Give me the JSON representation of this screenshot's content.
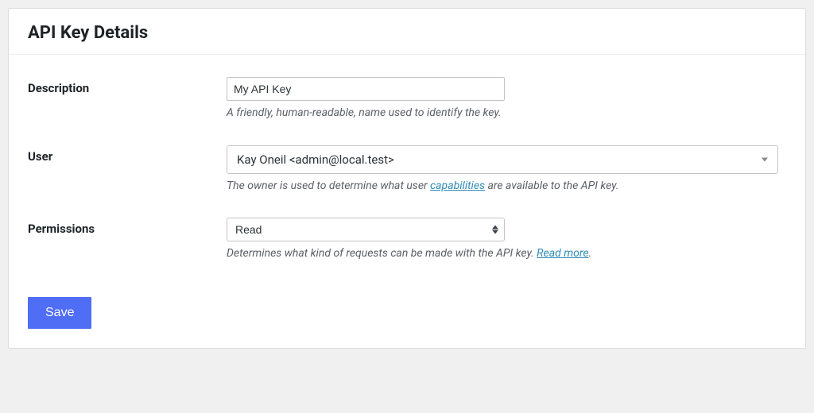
{
  "header": {
    "title": "API Key Details"
  },
  "form": {
    "description": {
      "label": "Description",
      "value": "My API Key",
      "help": "A friendly, human-readable, name used to identify the key."
    },
    "user": {
      "label": "User",
      "value": "Kay Oneil <admin@local.test>",
      "help_pre": "The owner is used to determine what user ",
      "help_link": "capabilities",
      "help_post": " are available to the API key."
    },
    "permissions": {
      "label": "Permissions",
      "value": "Read",
      "help_pre": "Determines what kind of requests can be made with the API key. ",
      "help_link": "Read more",
      "help_post": "."
    }
  },
  "actions": {
    "save": "Save"
  }
}
